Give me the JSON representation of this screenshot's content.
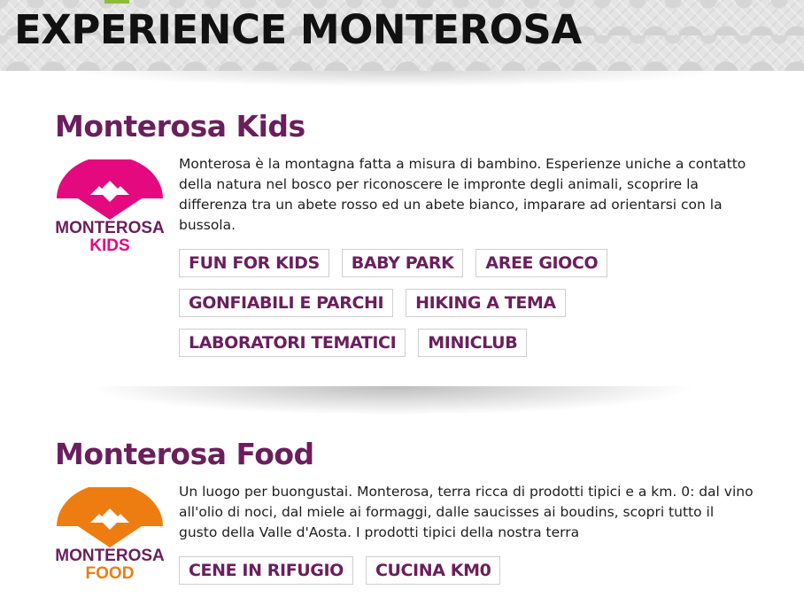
{
  "banner": {
    "title": "EXPERIENCE MONTEROSA"
  },
  "sections": {
    "kids": {
      "title": "Monterosa Kids",
      "logo": {
        "line1": "MONTEROSA",
        "line2": "KIDS",
        "color": "#e5097f"
      },
      "description": "Monterosa è la montagna fatta a misura di bambino. Esperienze uniche a contatto della natura nel bosco per riconoscere le impronte degli animali, scoprire la differenza tra un abete rosso ed un abete bianco, imparare ad orientarsi con la bussola.",
      "tags": [
        "FUN FOR KIDS",
        "BABY PARK",
        "AREE GIOCO",
        "GONFIABILI E PARCHI",
        "HIKING A TEMA",
        "LABORATORI TEMATICI",
        "MINICLUB"
      ]
    },
    "food": {
      "title": "Monterosa Food",
      "logo": {
        "line1": "MONTEROSA",
        "line2": "FOOD",
        "color": "#ee7d11"
      },
      "description": "Un luogo per buongustai. Monterosa, terra ricca di prodotti tipici e a km. 0: dal vino all'olio di noci, dal miele ai formaggi, dalle saucisses ai boudins, scopri tutto il gusto della Valle d'Aosta. I prodotti tipici della nostra terra",
      "tags": [
        "CENE IN RIFUGIO",
        "CUCINA KM0"
      ]
    }
  },
  "colors": {
    "title": "#6a1f5c",
    "accent_green": "#8dbb3a"
  }
}
